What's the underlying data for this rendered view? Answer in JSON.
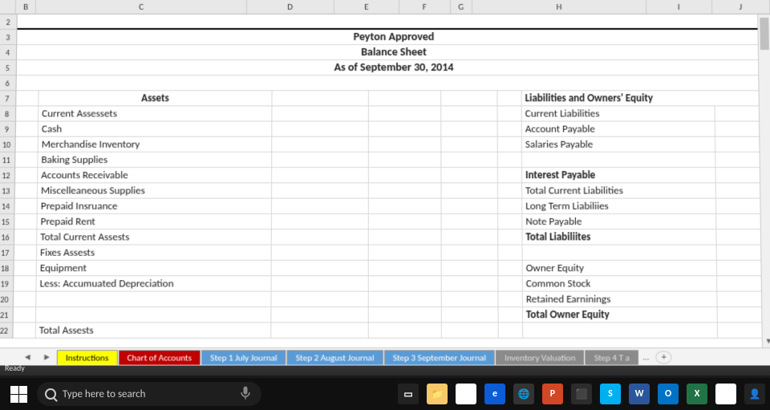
{
  "columns": [
    "B",
    "C",
    "D",
    "E",
    "F",
    "G",
    "H",
    "I",
    "J"
  ],
  "rows": [
    "2",
    "3",
    "4",
    "5",
    "6",
    "7",
    "8",
    "9",
    "10",
    "11",
    "12",
    "13",
    "14",
    "15",
    "16",
    "17",
    "18",
    "19",
    "20",
    "21",
    "22"
  ],
  "title": {
    "company": "Peyton Approved",
    "report": "Balance Sheet",
    "date": "As of September 30, 2014"
  },
  "sections": {
    "assets_header": "Assets",
    "liab_header": "Liabilities and Owners' Equity"
  },
  "assets": [
    "Current Assessets",
    "Cash",
    "Merchandise Inventory",
    "Baking Supplies",
    "Accounts Receivable",
    "Miscelleaneous Supplies",
    "Prepaid Insruance",
    "Prepaid Rent",
    "Total Current Assests",
    "Fixes Assests",
    "Equipment",
    "Less: Accumuated Depreciation",
    "",
    "",
    "Total Assests"
  ],
  "liabilities": [
    "Current Liabilities",
    "Account Payable",
    "Salaries Payable",
    "",
    "Interest Payable",
    "Total Current Liabilities",
    "Long Term Liabiliies",
    "Note Payable",
    "Total Liabiliites",
    "",
    "Owner Equity",
    "Common Stock",
    "Retained Earninings",
    "Total Owner Equity",
    ""
  ],
  "liab_bold": [
    false,
    false,
    false,
    false,
    true,
    false,
    false,
    false,
    true,
    false,
    false,
    false,
    false,
    true,
    false
  ],
  "tabs": [
    {
      "label": "Instructions",
      "cls": "yellow"
    },
    {
      "label": "Chart of Accounts",
      "cls": "red"
    },
    {
      "label": "Step 1 July Journal",
      "cls": "blue"
    },
    {
      "label": "Step 2 August Journal",
      "cls": "blue"
    },
    {
      "label": "Step 3 September Journal",
      "cls": "blue"
    },
    {
      "label": "Inventory Valuation",
      "cls": "gray"
    },
    {
      "label": "Step 4 T a",
      "cls": "gray"
    }
  ],
  "tab_more": "...",
  "tab_add": "+",
  "status": "Ready",
  "search_placeholder": "Type here to search",
  "task_icons": [
    {
      "name": "taskview-icon",
      "bg": "#222",
      "txt": "▭"
    },
    {
      "name": "explorer-icon",
      "bg": "#f8c96b",
      "txt": "📁"
    },
    {
      "name": "store-icon",
      "bg": "#fff",
      "txt": "🛍"
    },
    {
      "name": "edge-icon",
      "bg": "#0b5cd6",
      "txt": "e"
    },
    {
      "name": "browser-icon",
      "bg": "#333",
      "txt": "🌐"
    },
    {
      "name": "powerpoint-icon",
      "bg": "#d24726",
      "txt": "P"
    },
    {
      "name": "app-icon",
      "bg": "#2c2c2c",
      "txt": "⬛"
    },
    {
      "name": "skype-icon",
      "bg": "#00aff0",
      "txt": "S"
    },
    {
      "name": "word-icon",
      "bg": "#2b579a",
      "txt": "W"
    },
    {
      "name": "outlook-icon",
      "bg": "#0072c6",
      "txt": "O"
    },
    {
      "name": "excel-icon",
      "bg": "#217346",
      "txt": "X"
    },
    {
      "name": "chrome-icon",
      "bg": "#fff",
      "txt": "◉"
    },
    {
      "name": "people-icon",
      "bg": "#222",
      "txt": "👤"
    }
  ]
}
